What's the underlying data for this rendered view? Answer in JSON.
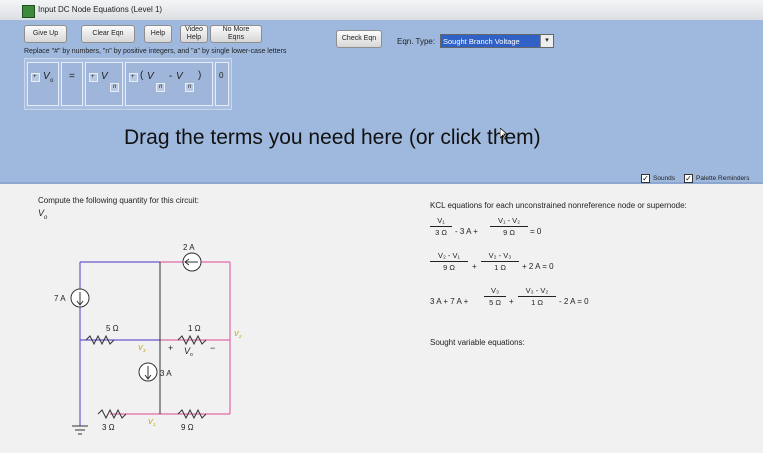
{
  "window": {
    "title": "Input DC Node Equations (Level 1)"
  },
  "toolbar": {
    "give_up": "Give Up",
    "clear_eqn": "Clear Eqn",
    "help": "Help",
    "video_help_1": "Video",
    "video_help_2": "Help",
    "no_more_1": "No More",
    "no_more_2": "Eqns",
    "check_eqn": "Check Eqn",
    "replace_note": "Replace \"#\" by numbers, \"n\" by positive integers, and \"a\" by single lower-case letters"
  },
  "eqn_type": {
    "label": "Eqn. Type:",
    "value": "Sought Branch Voltage",
    "arrow": "▾"
  },
  "palette": {
    "plus": "+",
    "minus": "-",
    "equals": "=",
    "v": "V",
    "o": "o",
    "n": "n",
    "open_paren": "(",
    "close_paren": ")",
    "zero": "0"
  },
  "drag_text": "Drag the terms you need here (or click them)",
  "options": {
    "sounds": "Sounds",
    "palette_reminders": "Palette Reminders",
    "check": "✓"
  },
  "problem": {
    "compute_label": "Compute the following quantity for this circuit:",
    "quantity": "V",
    "quantity_sub": "o"
  },
  "circuit": {
    "source_top": "2 A",
    "source_left": "7 A",
    "source_mid": "3 A",
    "r5": "5 Ω",
    "r1": "1 Ω",
    "r3": "3 Ω",
    "r9": "9 Ω",
    "v1": "V",
    "v1_sub": "1",
    "v2": "V",
    "v2_sub": "2",
    "v3": "V",
    "v3_sub": "3",
    "vo": "V",
    "vo_sub": "o",
    "plus": "+",
    "minus": "−"
  },
  "kcl": {
    "title": "KCL equations for each unconstrained nonreference node or supernode:",
    "eq1": {
      "t1_num": "V₁",
      "t1_den": "3 Ω",
      "mid": "- 3 A +",
      "t2_num": "V₁ - V₂",
      "t2_den": "9 Ω",
      "end": "= 0"
    },
    "eq2": {
      "t1_num": "V₂ - V₁",
      "t1_den": "9 Ω",
      "mid": "+",
      "t2_num": "V₂ - V₃",
      "t2_den": "1 Ω",
      "end": "+ 2 A = 0"
    },
    "eq3": {
      "pre": "3 A + 7 A +",
      "t1_num": "V₃",
      "t1_den": "5 Ω",
      "mid": "+",
      "t2_num": "V₃ - V₂",
      "t2_den": "1 Ω",
      "end": "- 2 A = 0"
    }
  },
  "sought": {
    "title": "Sought variable equations:"
  }
}
